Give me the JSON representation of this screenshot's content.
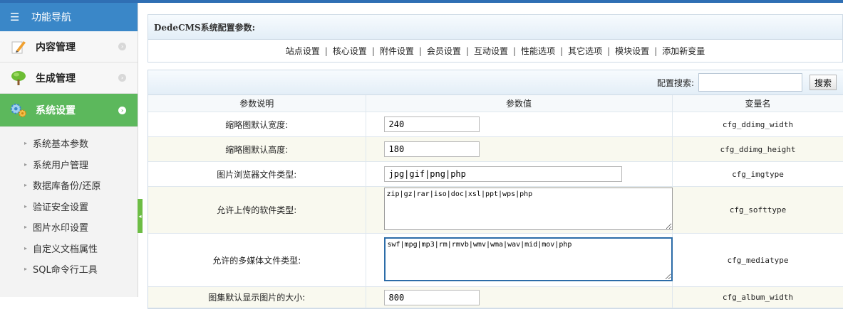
{
  "sidebar": {
    "header": "功能导航",
    "items": [
      {
        "label": "内容管理",
        "icon": "pencil-icon"
      },
      {
        "label": "生成管理",
        "icon": "tree-icon"
      },
      {
        "label": "系统设置",
        "icon": "gears-icon"
      }
    ],
    "submenu": [
      "系统基本参数",
      "系统用户管理",
      "数据库备份/还原",
      "验证安全设置",
      "图片水印设置",
      "自定义文档属性",
      "SQL命令行工具"
    ]
  },
  "main": {
    "title": "DedeCMS系统配置参数:",
    "tabs": [
      "站点设置",
      "核心设置",
      "附件设置",
      "会员设置",
      "互动设置",
      "性能选项",
      "其它选项",
      "模块设置",
      "添加新变量"
    ],
    "search_label": "配置搜索:",
    "search_value": "",
    "search_button": "搜索",
    "columns": [
      "参数说明",
      "参数值",
      "变量名"
    ],
    "rows": [
      {
        "desc": "缩略图默认宽度:",
        "value": "240",
        "var": "cfg_ddimg_width"
      },
      {
        "desc": "缩略图默认高度:",
        "value": "180",
        "var": "cfg_ddimg_height"
      },
      {
        "desc": "图片浏览器文件类型:",
        "value": "jpg|gif|png|php",
        "var": "cfg_imgtype"
      },
      {
        "desc": "允许上传的软件类型:",
        "value": "zip|gz|rar|iso|doc|xsl|ppt|wps|php",
        "var": "cfg_softtype"
      },
      {
        "desc": "允许的多媒体文件类型:",
        "value": "swf|mpg|mp3|rm|rmvb|wmv|wma|wav|mid|mov|php",
        "var": "cfg_mediatype"
      },
      {
        "desc": "图集默认显示图片的大小:",
        "value": "800",
        "var": "cfg_album_width"
      }
    ]
  }
}
